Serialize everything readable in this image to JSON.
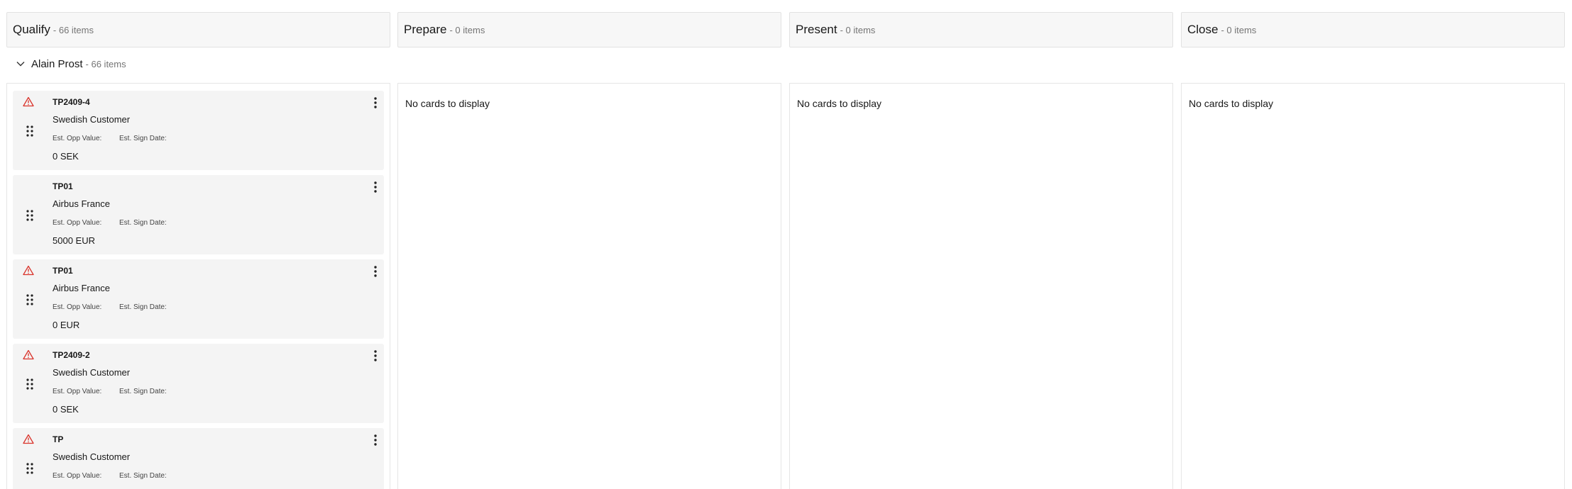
{
  "columns": [
    {
      "name": "Qualify",
      "count": "- 66 items"
    },
    {
      "name": "Prepare",
      "count": "- 0 items"
    },
    {
      "name": "Present",
      "count": "- 0 items"
    },
    {
      "name": "Close",
      "count": "- 0 items"
    }
  ],
  "lane": {
    "name": "Alain Prost",
    "count": "- 66 items"
  },
  "empty_message": "No cards to display",
  "card_labels": {
    "opp_value": "Est. Opp Value:",
    "sign_date": "Est. Sign Date:"
  },
  "cards": [
    {
      "title": "TP2409-4",
      "account": "Swedish Customer",
      "value": "0 SEK",
      "warning": true
    },
    {
      "title": "TP01",
      "account": "Airbus France",
      "value": "5000 EUR",
      "warning": false
    },
    {
      "title": "TP01",
      "account": "Airbus France",
      "value": "0 EUR",
      "warning": true
    },
    {
      "title": "TP2409-2",
      "account": "Swedish Customer",
      "value": "0 SEK",
      "warning": true
    },
    {
      "title": "TP",
      "account": "Swedish Customer",
      "value": "",
      "warning": true
    }
  ],
  "colors": {
    "warning": "#d9332b",
    "header_bg": "#f7f7f7",
    "card_bg": "#f4f4f4"
  },
  "icons": {
    "warning": "warning-triangle-icon",
    "drag": "drag-handle-icon",
    "menu": "more-vertical-icon",
    "chevron": "chevron-down-icon",
    "settings": "gear-icon"
  }
}
